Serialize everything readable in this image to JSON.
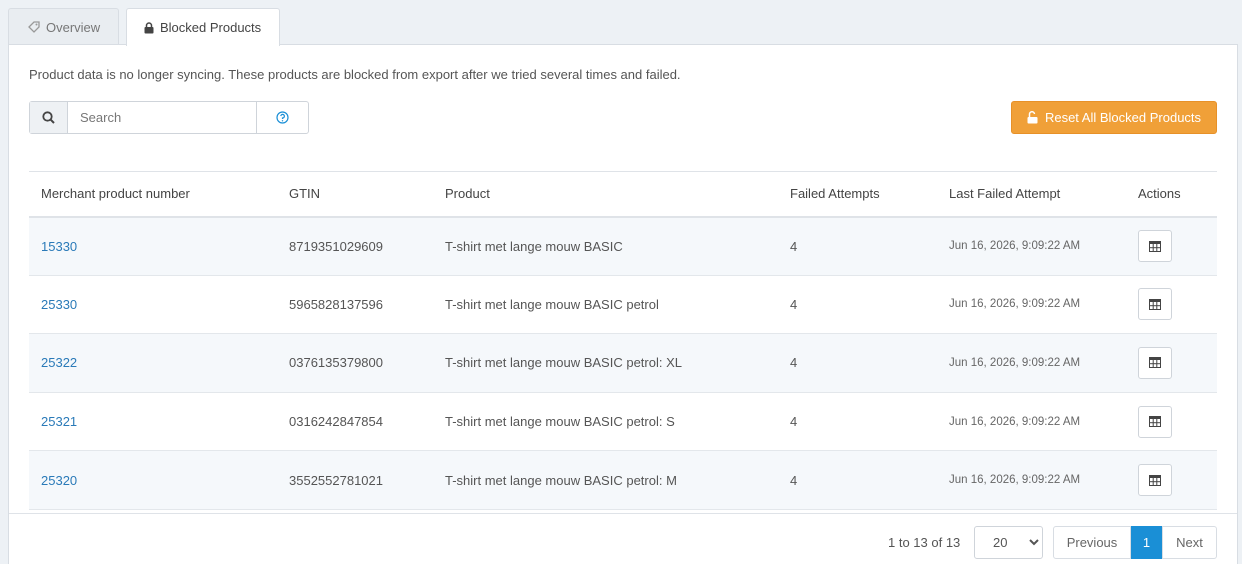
{
  "tabs": [
    {
      "label": "Overview",
      "icon": "tag-icon"
    },
    {
      "label": "Blocked Products",
      "icon": "lock-icon"
    }
  ],
  "info_text": "Product data is no longer syncing. These products are blocked from export after we tried several times and failed.",
  "search": {
    "placeholder": "Search",
    "value": ""
  },
  "reset_button": "Reset All Blocked Products",
  "table": {
    "headers": [
      "Merchant product number",
      "GTIN",
      "Product",
      "Failed Attempts",
      "Last Failed Attempt",
      "Actions"
    ],
    "rows": [
      {
        "mpn": "15330",
        "gtin": "8719351029609",
        "product": "T-shirt met lange mouw BASIC",
        "attempts": "4",
        "last": "Jun 16, 2026, 9:09:22 AM"
      },
      {
        "mpn": "25330",
        "gtin": "5965828137596",
        "product": "T-shirt met lange mouw BASIC petrol",
        "attempts": "4",
        "last": "Jun 16, 2026, 9:09:22 AM"
      },
      {
        "mpn": "25322",
        "gtin": "0376135379800",
        "product": "T-shirt met lange mouw BASIC petrol: XL",
        "attempts": "4",
        "last": "Jun 16, 2026, 9:09:22 AM"
      },
      {
        "mpn": "25321",
        "gtin": "0316242847854",
        "product": "T-shirt met lange mouw BASIC petrol: S",
        "attempts": "4",
        "last": "Jun 16, 2026, 9:09:22 AM"
      },
      {
        "mpn": "25320",
        "gtin": "3552552781021",
        "product": "T-shirt met lange mouw BASIC petrol: M",
        "attempts": "4",
        "last": "Jun 16, 2026, 9:09:22 AM"
      }
    ]
  },
  "pagination": {
    "range_text": "1 to 13 of 13",
    "page_size": "20",
    "previous": "Previous",
    "current_page": "1",
    "next": "Next"
  },
  "colors": {
    "accent": "#1a8fd6",
    "warning": "#f0a038",
    "link": "#2a7ab8"
  }
}
